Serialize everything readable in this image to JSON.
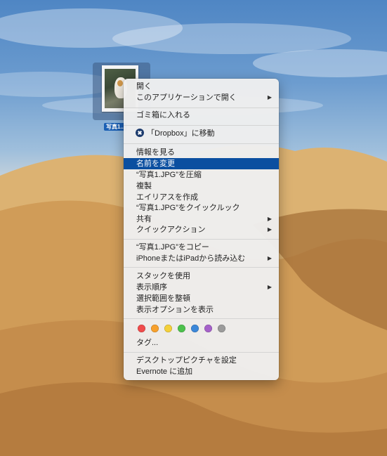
{
  "desktop": {
    "file_label": "写真1...",
    "file_icon": "jpeg-thumbnail-icon"
  },
  "menu": {
    "items": [
      {
        "label": "開く",
        "arrow": ""
      },
      {
        "label": "このアプリケーションで開く",
        "arrow": "▶"
      },
      {
        "label": "ゴミ箱に入れる",
        "arrow": ""
      },
      {
        "label": "「Dropbox」に移動",
        "arrow": "",
        "icon": "dropbox-icon"
      },
      {
        "label": "情報を見る",
        "arrow": ""
      },
      {
        "label": "名前を変更",
        "arrow": "",
        "selected": true
      },
      {
        "label": "“写真1.JPG”を圧縮",
        "arrow": ""
      },
      {
        "label": "複製",
        "arrow": ""
      },
      {
        "label": "エイリアスを作成",
        "arrow": ""
      },
      {
        "label": "“写真1.JPG”をクイックルック",
        "arrow": ""
      },
      {
        "label": "共有",
        "arrow": "▶"
      },
      {
        "label": "クイックアクション",
        "arrow": "▶"
      },
      {
        "label": "“写真1.JPG”をコピー",
        "arrow": ""
      },
      {
        "label": "iPhoneまたはiPadから読み込む",
        "arrow": "▶"
      },
      {
        "label": "スタックを使用",
        "arrow": ""
      },
      {
        "label": "表示順序",
        "arrow": "▶"
      },
      {
        "label": "選択範囲を整頓",
        "arrow": ""
      },
      {
        "label": "表示オプションを表示",
        "arrow": ""
      },
      {
        "label": "タグ...",
        "arrow": ""
      },
      {
        "label": "デスクトップピクチャを設定",
        "arrow": ""
      },
      {
        "label": "Evernote に追加",
        "arrow": ""
      }
    ],
    "tag_colors": [
      "#f04b4b",
      "#f7a02c",
      "#f4d03a",
      "#4cc14c",
      "#3b87d9",
      "#a561c9",
      "#9b9b9b"
    ],
    "accent_color": "#0b4fa0"
  }
}
